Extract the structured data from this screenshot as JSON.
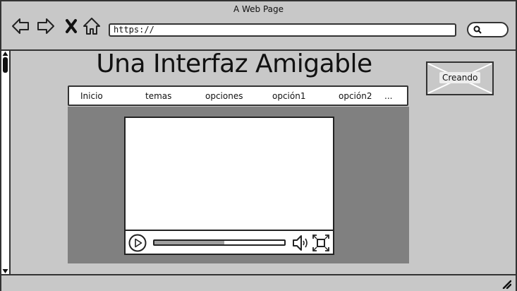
{
  "window": {
    "title": "A Web Page"
  },
  "toolbar": {
    "url": "https://",
    "back_icon": "arrow-left-icon",
    "forward_icon": "arrow-right-icon",
    "close_icon": "close-icon",
    "home_icon": "home-icon",
    "search_icon": "search-icon"
  },
  "page": {
    "title": "Una Interfaz Amigable",
    "nav": [
      "Inicio",
      "temas",
      "opciones",
      "opción1",
      "opción2",
      "..."
    ],
    "image_placeholder": {
      "label": "Creando"
    }
  },
  "video": {
    "progress": 0.54,
    "play_icon": "play-icon",
    "volume_icon": "volume-icon",
    "fullscreen_icon": "fullscreen-icon"
  },
  "colors": {
    "window_bg": "#c8c8c8",
    "content_panel": "#808080",
    "border": "#333333"
  }
}
